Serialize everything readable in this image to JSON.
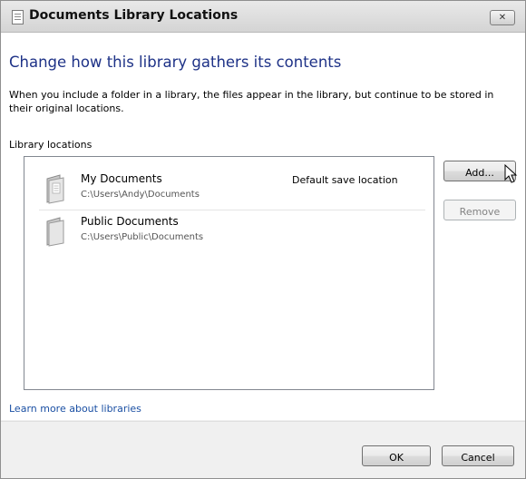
{
  "window": {
    "title": "Documents Library Locations",
    "close_glyph": "✕"
  },
  "heading": "Change how this library gathers its contents",
  "description": "When you include a folder in a library, the files appear in the library, but continue to be stored in their original locations.",
  "locations_label": "Library locations",
  "locations": [
    {
      "name": "My Documents",
      "path": "C:\\Users\\Andy\\Documents",
      "note": "Default save location",
      "icon": "folder-icon"
    },
    {
      "name": "Public Documents",
      "path": "C:\\Users\\Public\\Documents",
      "note": "",
      "icon": "folder-icon"
    }
  ],
  "buttons": {
    "add": "Add...",
    "remove": "Remove",
    "ok": "OK",
    "cancel": "Cancel"
  },
  "learn_more_link": "Learn more about libraries",
  "colors": {
    "heading": "#1e3287",
    "link": "#1a4fa3",
    "disabled_text": "#838383"
  }
}
